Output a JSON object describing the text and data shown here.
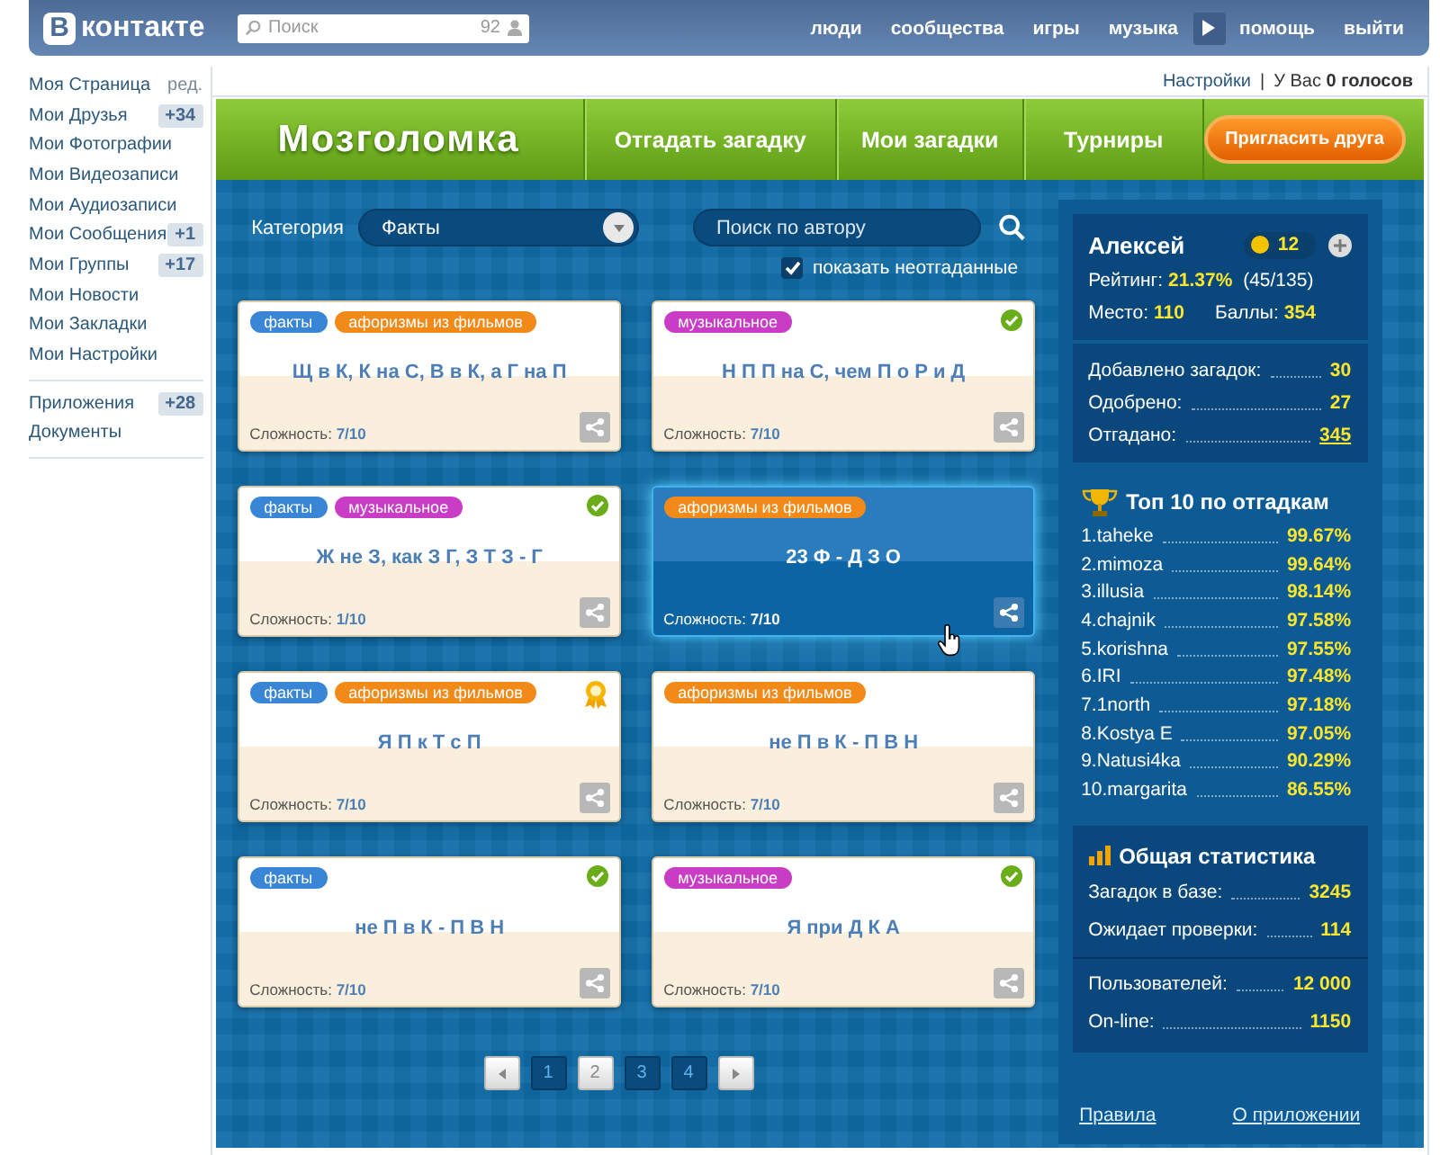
{
  "header": {
    "logo_letter": "В",
    "logo_text": "контакте",
    "search": {
      "placeholder": "Поиск",
      "count": "92"
    },
    "nav": [
      "люди",
      "сообщества",
      "игры",
      "музыка",
      "помощь",
      "выйти"
    ]
  },
  "sidebar": {
    "groups": [
      [
        {
          "label": "Моя Страница",
          "extra": "ред.",
          "kind": "link"
        },
        {
          "label": "Мои Друзья",
          "extra": "+34",
          "kind": "count"
        },
        {
          "label": "Мои Фотографии"
        },
        {
          "label": "Мои Видеозаписи"
        },
        {
          "label": "Мои Аудиозаписи"
        },
        {
          "label": "Мои Сообщения",
          "extra": "+1",
          "kind": "count"
        },
        {
          "label": "Мои Группы",
          "extra": "+17",
          "kind": "count"
        },
        {
          "label": "Мои Новости"
        },
        {
          "label": "Мои Закладки"
        },
        {
          "label": "Мои Настройки"
        }
      ],
      [
        {
          "label": "Приложения",
          "extra": "+28",
          "kind": "count"
        },
        {
          "label": "Документы"
        }
      ]
    ]
  },
  "app_top": {
    "settings": "Настройки",
    "separator": "|",
    "votes_prefix": "У Вас",
    "votes": "0 голосов"
  },
  "app_bar": {
    "title": "Мозголомка",
    "tabs": [
      "Отгадать загадку",
      "Мои загадки",
      "Турниры"
    ],
    "invite": "Пригласить друга"
  },
  "filters": {
    "category_label": "Категория",
    "category": "Факты",
    "author_placeholder": "Поиск по автору",
    "show_unsolved": {
      "label": "показать неотгаданные",
      "checked": true
    }
  },
  "cards": [
    {
      "tags": [
        {
          "label": "факты",
          "color": "#3a86d6"
        },
        {
          "label": "афоризмы из фильмов",
          "color": "#f28a1a"
        }
      ],
      "solved": false,
      "awarded": false,
      "text": "Щ в К, К на С, В в К, а Г на П",
      "difficulty_label": "Сложность:",
      "difficulty": "7/10",
      "selected": false
    },
    {
      "tags": [
        {
          "label": "музыкальное",
          "color": "#c93cc6"
        }
      ],
      "solved": true,
      "awarded": false,
      "text": "Н П П на С, чем П о Р и Д",
      "difficulty_label": "Сложность:",
      "difficulty": "7/10",
      "selected": false
    },
    {
      "tags": [
        {
          "label": "факты",
          "color": "#3a86d6"
        },
        {
          "label": "музыкальное",
          "color": "#c93cc6"
        }
      ],
      "solved": true,
      "awarded": false,
      "text": "Ж не З, как З Г, З Т З - Г",
      "difficulty_label": "Сложность:",
      "difficulty": "1/10",
      "selected": false
    },
    {
      "tags": [
        {
          "label": "афоризмы из фильмов",
          "color": "#f28a1a"
        }
      ],
      "solved": false,
      "awarded": false,
      "text": "23 Ф - Д З О",
      "difficulty_label": "Сложность:",
      "difficulty": "7/10",
      "selected": true
    },
    {
      "tags": [
        {
          "label": "факты",
          "color": "#3a86d6"
        },
        {
          "label": "афоризмы из фильмов",
          "color": "#f28a1a"
        }
      ],
      "solved": false,
      "awarded": true,
      "text": "Я П к Т с П",
      "difficulty_label": "Сложность:",
      "difficulty": "7/10",
      "selected": false
    },
    {
      "tags": [
        {
          "label": "афоризмы из фильмов",
          "color": "#f28a1a"
        }
      ],
      "solved": false,
      "awarded": false,
      "text": "не П в К - П В Н",
      "difficulty_label": "Сложность:",
      "difficulty": "7/10",
      "selected": false
    },
    {
      "tags": [
        {
          "label": "факты",
          "color": "#3a86d6"
        }
      ],
      "solved": true,
      "awarded": false,
      "text": "не П в К - П В Н",
      "difficulty_label": "Сложность:",
      "difficulty": "7/10",
      "selected": false
    },
    {
      "tags": [
        {
          "label": "музыкальное",
          "color": "#c93cc6"
        }
      ],
      "solved": true,
      "awarded": false,
      "text": "Я при Д К А",
      "difficulty_label": "Сложность:",
      "difficulty": "7/10",
      "selected": false
    }
  ],
  "pagination": [
    {
      "label": "1",
      "selected": false
    },
    {
      "label": "2",
      "selected": true
    },
    {
      "label": "3",
      "selected": false
    },
    {
      "label": "4",
      "selected": false
    }
  ],
  "profile": {
    "name": "Алексей",
    "coins": "12",
    "rating_label": "Рейтинг:",
    "rating": "21.37%",
    "rating_detail": "(45/135)",
    "place_label": "Место:",
    "place": "110",
    "points_label": "Баллы:",
    "points": "354",
    "stats": [
      {
        "label": "Добавлено загадок:",
        "value": "30",
        "link": false
      },
      {
        "label": "Одобрено:",
        "value": "27",
        "link": false
      },
      {
        "label": "Отгадано:",
        "value": "345",
        "link": true
      }
    ]
  },
  "top": {
    "title": "Топ 10 по отгадкам",
    "rows": [
      {
        "name": "1.taheke",
        "value": "99.67%"
      },
      {
        "name": "2.mimoza",
        "value": "99.64%"
      },
      {
        "name": "3.illusia",
        "value": "98.14%"
      },
      {
        "name": "4.chajnik",
        "value": "97.58%"
      },
      {
        "name": "5.korishna",
        "value": "97.55%"
      },
      {
        "name": "6.IRI",
        "value": "97.48%"
      },
      {
        "name": "7.1north",
        "value": "97.18%"
      },
      {
        "name": "8.Kostya E",
        "value": "97.05%"
      },
      {
        "name": "9.Natusi4ka",
        "value": "90.29%"
      },
      {
        "name": "10.margarita",
        "value": "86.55%"
      }
    ]
  },
  "general": {
    "title": "Общая статистика",
    "groups": [
      [
        {
          "label": "Загадок в базе:",
          "value": "3245"
        },
        {
          "label": "Ожидает проверки:",
          "value": "114"
        }
      ],
      [
        {
          "label": "Пользователей:",
          "value": "12 000"
        },
        {
          "label": "On-line:",
          "value": "1150"
        }
      ]
    ]
  },
  "footer_links": [
    "Правила",
    "О приложении"
  ]
}
